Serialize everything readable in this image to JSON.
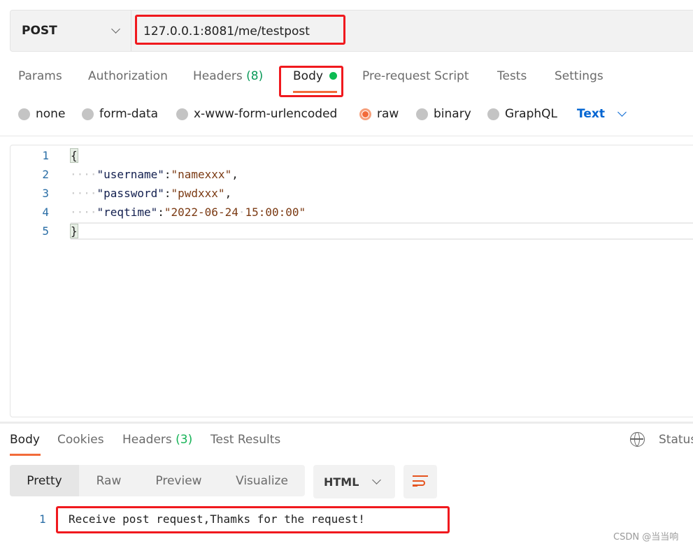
{
  "request": {
    "method": "POST",
    "url": "127.0.0.1:8081/me/testpost"
  },
  "tabs": {
    "params": "Params",
    "authorization": "Authorization",
    "headers": "Headers",
    "headers_count": "(8)",
    "body": "Body",
    "prerequest": "Pre-request Script",
    "tests": "Tests",
    "settings": "Settings"
  },
  "body_types": {
    "none": "none",
    "form_data": "form-data",
    "urlencoded": "x-www-form-urlencoded",
    "raw": "raw",
    "binary": "binary",
    "graphql": "GraphQL",
    "selected": "raw",
    "format": "Text"
  },
  "editor": {
    "lines": [
      "1",
      "2",
      "3",
      "4",
      "5"
    ],
    "open": "{",
    "close": "}",
    "k1": "\"username\"",
    "v1": "\"namexxx\"",
    "k2": "\"password\"",
    "v2": "\"pwdxxx\"",
    "k3": "\"reqtime\"",
    "v3a": "\"2022-06-24",
    "v3b": "15:00:00\""
  },
  "response": {
    "tabs": {
      "body": "Body",
      "cookies": "Cookies",
      "headers": "Headers",
      "headers_count": "(3)",
      "tests": "Test Results"
    },
    "status": "Status",
    "views": {
      "pretty": "Pretty",
      "raw": "Raw",
      "preview": "Preview",
      "visualize": "Visualize"
    },
    "format": "HTML",
    "line": "1",
    "text": "Receive post request,Thamks for the request!"
  },
  "watermark": "CSDN @当当响",
  "colors": {
    "accent": "#f26b3a",
    "highlight": "#f0191e",
    "success": "#0c9a5a",
    "link": "#0265d2"
  }
}
